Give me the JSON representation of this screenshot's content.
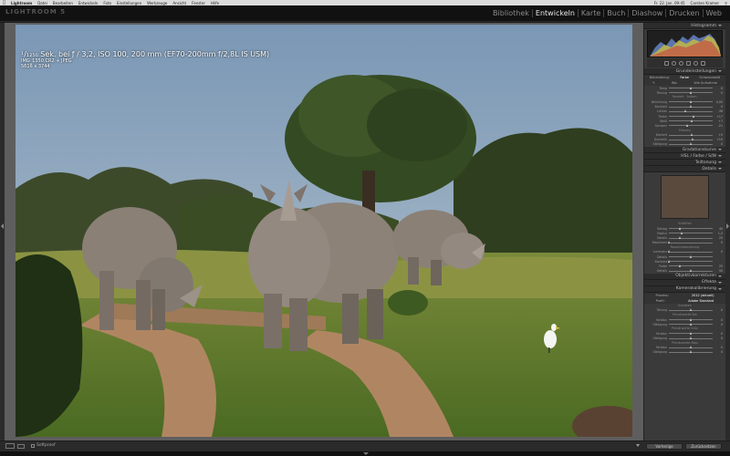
{
  "os_menubar": {
    "app_name": "Lightroom",
    "items": [
      "Datei",
      "Bearbeiten",
      "Entwickeln",
      "Foto",
      "Einstellungen",
      "Werkzeuge",
      "Ansicht",
      "Fenster",
      "Hilfe"
    ],
    "clock": "Fr. 22. Jan. 09:45",
    "user": "Carsten Kramer"
  },
  "app": {
    "logo": "LIGHTROOM 5"
  },
  "modules": [
    {
      "label": "Bibliothek",
      "active": false
    },
    {
      "label": "Entwickeln",
      "active": true
    },
    {
      "label": "Karte",
      "active": false
    },
    {
      "label": "Buch",
      "active": false
    },
    {
      "label": "Diashow",
      "active": false
    },
    {
      "label": "Drucken",
      "active": false
    },
    {
      "label": "Web",
      "active": false
    }
  ],
  "photo_info": {
    "exposure_line": "¹/₁₂₅₀ Sek. bei ƒ / 3,2, ISO 100, 200 mm (EF70-200mm f/2,8L IS USM)",
    "file_line": "IMG_1350.CR2 + JPEG",
    "size_line": "5616 x 3744"
  },
  "panel": {
    "histogram_label": "Histogramm",
    "basic_label": "Grundeinstellungen",
    "treatment_tabs": [
      "Behandlung:",
      "Farbe",
      "Schwarzweiß"
    ],
    "wb_label": "WA:",
    "wb_value": "Wie Aufnahme",
    "wb_sliders": [
      {
        "label": "Temp",
        "value": "0",
        "pos": 0.5
      },
      {
        "label": "Tönung",
        "value": "0",
        "pos": 0.5
      }
    ],
    "tone_header": "Tonwert",
    "tone_auto": "Autom.",
    "tone_sliders": [
      {
        "label": "Belichtung",
        "value": "0,00",
        "pos": 0.5
      },
      {
        "label": "Kontrast",
        "value": "0",
        "pos": 0.5
      },
      {
        "label": "Lichter",
        "value": "-36",
        "pos": 0.38
      },
      {
        "label": "Tiefen",
        "value": "+17",
        "pos": 0.58
      },
      {
        "label": "Weiß",
        "value": "+7",
        "pos": 0.53
      },
      {
        "label": "Schwarz",
        "value": "-21",
        "pos": 0.42
      }
    ],
    "presence_header": "Präsenz",
    "presence_sliders": [
      {
        "label": "Klarheit",
        "value": "+5",
        "pos": 0.53
      },
      {
        "label": "Dynamik",
        "value": "+10",
        "pos": 0.55
      },
      {
        "label": "Sättigung",
        "value": "0",
        "pos": 0.5
      }
    ],
    "tone_curve_label": "Gradationskurve",
    "hsl_label": "HSL / Farbe / S/W",
    "split_toning_label": "Teiltonung",
    "detail_label": "Details",
    "sharpen_header": "Schärfen",
    "sharpen_sliders": [
      {
        "label": "Betrag",
        "value": "40",
        "pos": 0.27
      },
      {
        "label": "Radius",
        "value": "1,0",
        "pos": 0.3
      },
      {
        "label": "Details",
        "value": "25",
        "pos": 0.25
      },
      {
        "label": "Maskieren",
        "value": "0",
        "pos": 0.02
      }
    ],
    "noise_header": "Rauschreduzierung",
    "noise_sliders": [
      {
        "label": "Luminanz",
        "value": "0",
        "pos": 0.02
      },
      {
        "label": "Details",
        "value": "",
        "pos": 0.5
      },
      {
        "label": "Kontrast",
        "value": "",
        "pos": 0.02
      },
      {
        "label": "Farbe",
        "value": "25",
        "pos": 0.25
      },
      {
        "label": "Details",
        "value": "50",
        "pos": 0.5
      }
    ],
    "lens_label": "Objektivkorrekturen",
    "effects_label": "Effekte",
    "calibration_label": "Kamerakalibrierung",
    "process_label": "Prozess:",
    "process_value": "2012 (aktuell)",
    "profile_label": "Profil:",
    "profile_value": "Adobe Standard",
    "shadows_header": "Schatten",
    "shadows_sliders": [
      {
        "label": "Tönung",
        "value": "0",
        "pos": 0.5
      }
    ],
    "red_header": "Primärwerte Rot",
    "red_sliders": [
      {
        "label": "Farbton",
        "value": "0",
        "pos": 0.5
      },
      {
        "label": "Sättigung",
        "value": "0",
        "pos": 0.5
      }
    ],
    "green_header": "Primärwerte Grün",
    "green_sliders": [
      {
        "label": "Farbton",
        "value": "0",
        "pos": 0.5
      },
      {
        "label": "Sättigung",
        "value": "0",
        "pos": 0.5
      }
    ],
    "blue_header": "Primärwerte Blau",
    "blue_sliders": [
      {
        "label": "Farbton",
        "value": "0",
        "pos": 0.5
      },
      {
        "label": "Sättigung",
        "value": "0",
        "pos": 0.5
      }
    ]
  },
  "bottom": {
    "softproof_label": "Softproof",
    "previous_button": "Vorherige",
    "reset_button": "Zurücksetzen"
  }
}
